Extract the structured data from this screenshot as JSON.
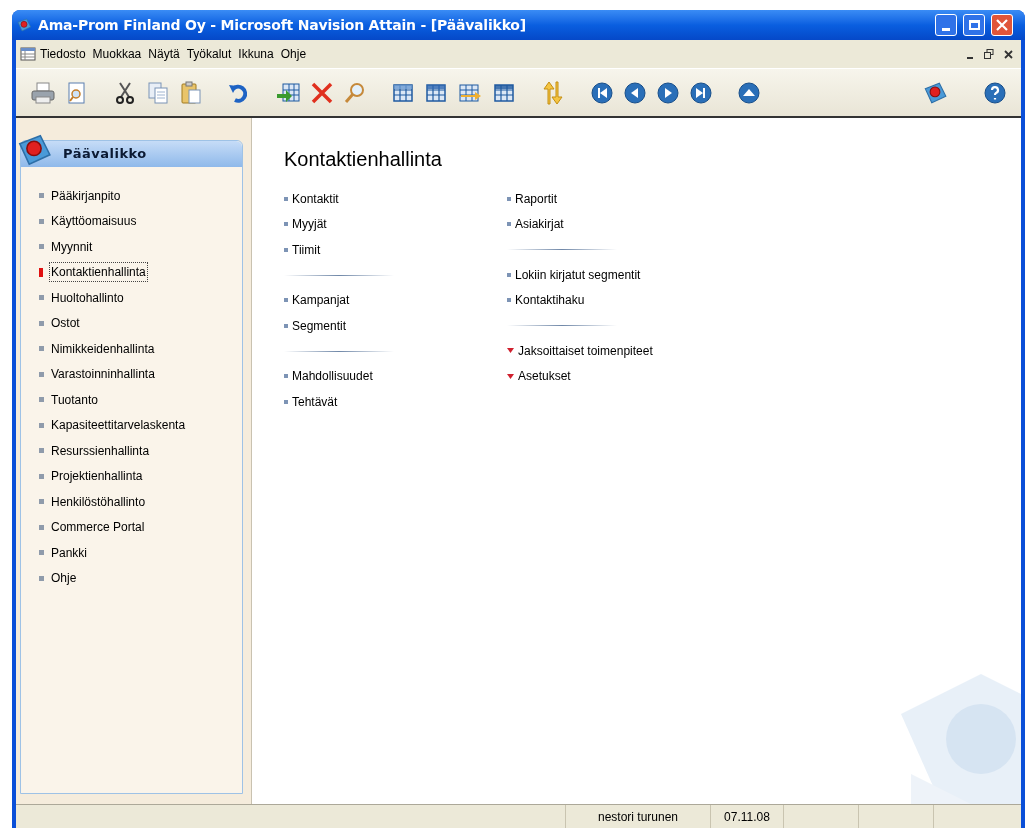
{
  "window": {
    "title": "Ama-Prom Finland Oy - Microsoft Navision Attain - [Päävalikko]"
  },
  "menu_bar": [
    "Tiedosto",
    "Muokkaa",
    "Näytä",
    "Työkalut",
    "Ikkuna",
    "Ohje"
  ],
  "sidebar": {
    "title": "Päävalikko",
    "items": [
      {
        "label": "Pääkirjanpito",
        "selected": false
      },
      {
        "label": "Käyttöomaisuus",
        "selected": false
      },
      {
        "label": "Myynnit",
        "selected": false
      },
      {
        "label": "Kontaktienhallinta",
        "selected": true
      },
      {
        "label": "Huoltohallinto",
        "selected": false
      },
      {
        "label": "Ostot",
        "selected": false
      },
      {
        "label": "Nimikkeidenhallinta",
        "selected": false
      },
      {
        "label": "Varastoinninhallinta",
        "selected": false
      },
      {
        "label": "Tuotanto",
        "selected": false
      },
      {
        "label": "Kapasiteettitarvelaskenta",
        "selected": false
      },
      {
        "label": "Resurssienhallinta",
        "selected": false
      },
      {
        "label": "Projektienhallinta",
        "selected": false
      },
      {
        "label": "Henkilöstöhallinto",
        "selected": false
      },
      {
        "label": "Commerce Portal",
        "selected": false
      },
      {
        "label": "Pankki",
        "selected": false
      },
      {
        "label": "Ohje",
        "selected": false
      }
    ]
  },
  "content": {
    "title": "Kontaktienhallinta",
    "columns": [
      [
        [
          {
            "label": "Kontaktit",
            "kind": "link"
          },
          {
            "label": "Myyjät",
            "kind": "link"
          },
          {
            "label": "Tiimit",
            "kind": "link"
          }
        ],
        [
          {
            "label": "Kampanjat",
            "kind": "link"
          },
          {
            "label": "Segmentit",
            "kind": "link"
          }
        ],
        [
          {
            "label": "Mahdollisuudet",
            "kind": "link"
          },
          {
            "label": "Tehtävät",
            "kind": "link"
          }
        ]
      ],
      [
        [
          {
            "label": "Raportit",
            "kind": "link"
          },
          {
            "label": "Asiakirjat",
            "kind": "link"
          }
        ],
        [
          {
            "label": "Lokiin kirjatut segmentit",
            "kind": "link"
          },
          {
            "label": "Kontaktihaku",
            "kind": "link"
          }
        ],
        [
          {
            "label": "Jaksoittaiset toimenpiteet",
            "kind": "submenu"
          },
          {
            "label": "Asetukset",
            "kind": "submenu"
          }
        ]
      ]
    ]
  },
  "status_bar": {
    "user": "nestori turunen",
    "date": "07.11.08"
  }
}
